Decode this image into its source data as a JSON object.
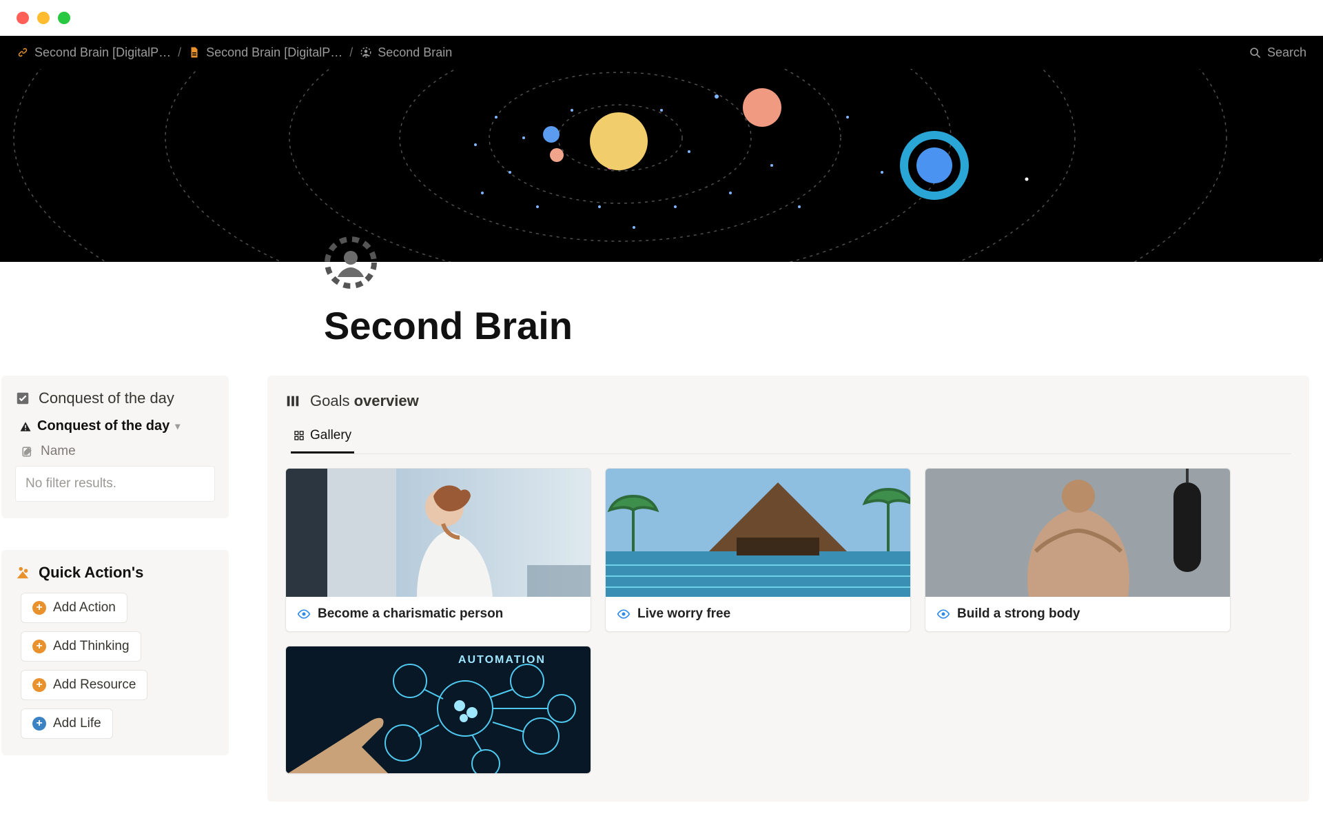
{
  "breadcrumbs": {
    "items": [
      {
        "label": "Second Brain [DigitalP…"
      },
      {
        "label": "Second Brain [DigitalP…"
      },
      {
        "label": "Second Brain"
      }
    ]
  },
  "topbar": {
    "search_label": "Search"
  },
  "page": {
    "title": "Second Brain"
  },
  "conquest": {
    "title": "Conquest of the day",
    "subhead": "Conquest of the day",
    "name_label": "Name",
    "no_filter": "No filter results."
  },
  "quick_actions": {
    "title": "Quick Action's",
    "buttons": [
      {
        "label": "Add Action",
        "color": "orange"
      },
      {
        "label": "Add Thinking",
        "color": "orange"
      },
      {
        "label": "Add Resource",
        "color": "orange"
      },
      {
        "label": "Add Life",
        "color": "blue"
      }
    ]
  },
  "goals": {
    "heading_prefix": "Goals ",
    "heading_suffix": "overview",
    "tab_gallery": "Gallery",
    "cards": [
      {
        "title": "Become a charismatic person"
      },
      {
        "title": "Live worry free"
      },
      {
        "title": "Build a strong body"
      },
      {
        "title": ""
      }
    ]
  },
  "colors": {
    "orange": "#e8912d",
    "blue_eye": "#2d8be8"
  }
}
